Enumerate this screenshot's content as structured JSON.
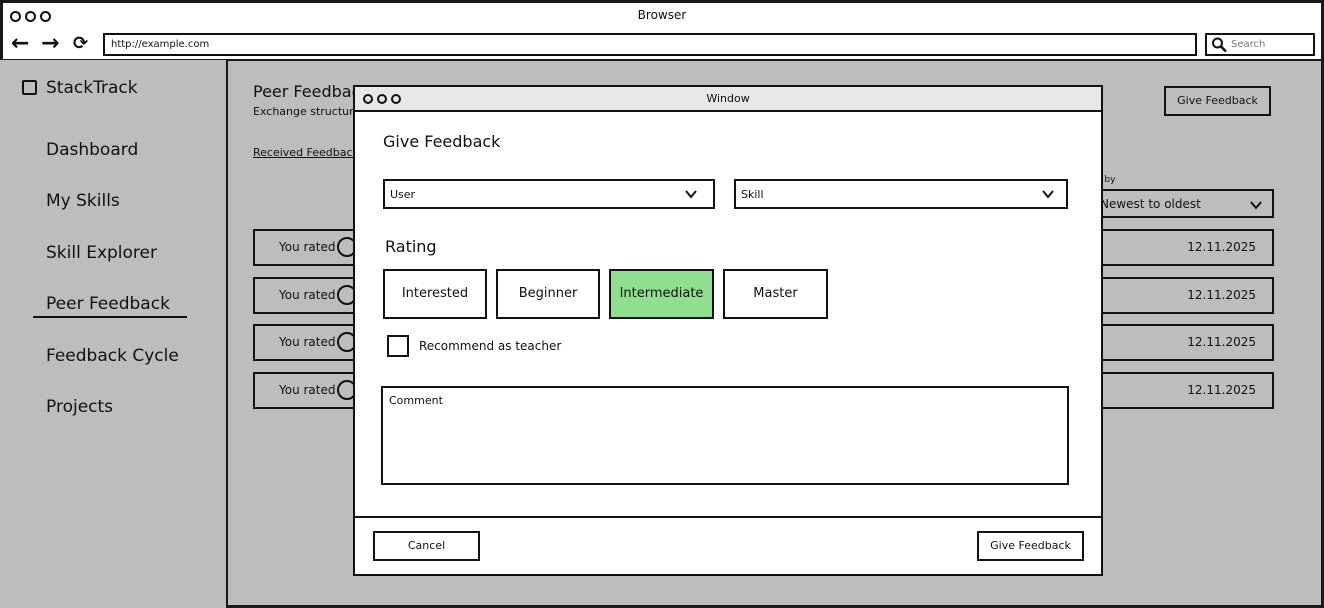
{
  "browser": {
    "window_title": "Browser",
    "url": "http://example.com",
    "search_placeholder": "Search"
  },
  "app": {
    "brand": "StackTrack",
    "nav": [
      {
        "label": "Dashboard"
      },
      {
        "label": "My Skills"
      },
      {
        "label": "Skill Explorer"
      },
      {
        "label": "Peer Feedback",
        "active": true
      },
      {
        "label": "Feedback Cycle"
      },
      {
        "label": "Projects"
      }
    ],
    "page_title": "Peer Feedback",
    "page_subtitle": "Exchange structured s",
    "tab_received": "Received Feedback",
    "give_feedback_button": "Give Feedback",
    "sort_label": "t by",
    "sort_value": "Newest to oldest",
    "rows": [
      {
        "text": "You rated",
        "date": "12.11.2025"
      },
      {
        "text": "You rated",
        "date": "12.11.2025"
      },
      {
        "text": "You rated",
        "date": "12.11.2025"
      },
      {
        "text": "You rated",
        "date": "12.11.2025"
      }
    ]
  },
  "modal": {
    "window_title": "Window",
    "heading": "Give Feedback",
    "user_select": "User",
    "skill_select": "Skill",
    "rating_label": "Rating",
    "rating_options": [
      "Interested",
      "Beginner",
      "Intermediate",
      "Master"
    ],
    "rating_selected": "Intermediate",
    "recommend_label": "Recommend as teacher",
    "recommend_checked": false,
    "comment_placeholder": "Comment",
    "cancel_button": "Cancel",
    "submit_button": "Give Feedback"
  },
  "colors": {
    "app_background": "#bdbdbd",
    "selected_rating": "#8ee08e"
  },
  "icons": {
    "back": "arrow-left-icon",
    "forward": "arrow-right-icon",
    "reload": "reload-icon",
    "search": "search-icon",
    "brand": "image-icon",
    "user": "user-circle-icon",
    "chevron": "chevron-down-icon"
  }
}
